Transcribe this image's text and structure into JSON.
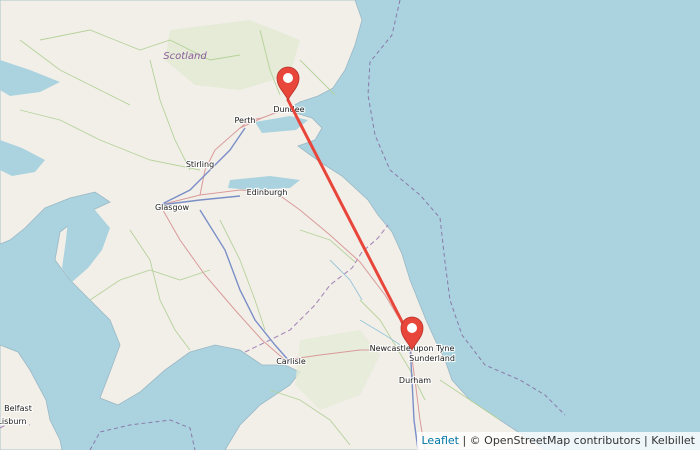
{
  "map": {
    "region_label": "Scotland",
    "places": {
      "dundee": "Dundee",
      "perth": "Perth",
      "stirling": "Stirling",
      "edinburgh": "Edinburgh",
      "glasgow": "Glasgow",
      "carlisle": "Carlisle",
      "newcastle": "Newcastle upon Tyne",
      "sunderland": "Sunderland",
      "durham": "Durham",
      "belfast": "Belfast",
      "lisburn": "Lisburn"
    },
    "markers": [
      {
        "id": "origin",
        "name": "Dundee"
      },
      {
        "id": "destination",
        "name": "Newcastle upon Tyne"
      }
    ],
    "route_color": "#e8463a",
    "marker_color": "#e8463a",
    "water_color": "#aad3df",
    "land_color": "#f2efe9"
  },
  "attribution": {
    "leaflet": "Leaflet",
    "separator": " | © ",
    "osm": "OpenStreetMap contributors",
    "separator2": " | ",
    "provider": "Kelbillet"
  }
}
